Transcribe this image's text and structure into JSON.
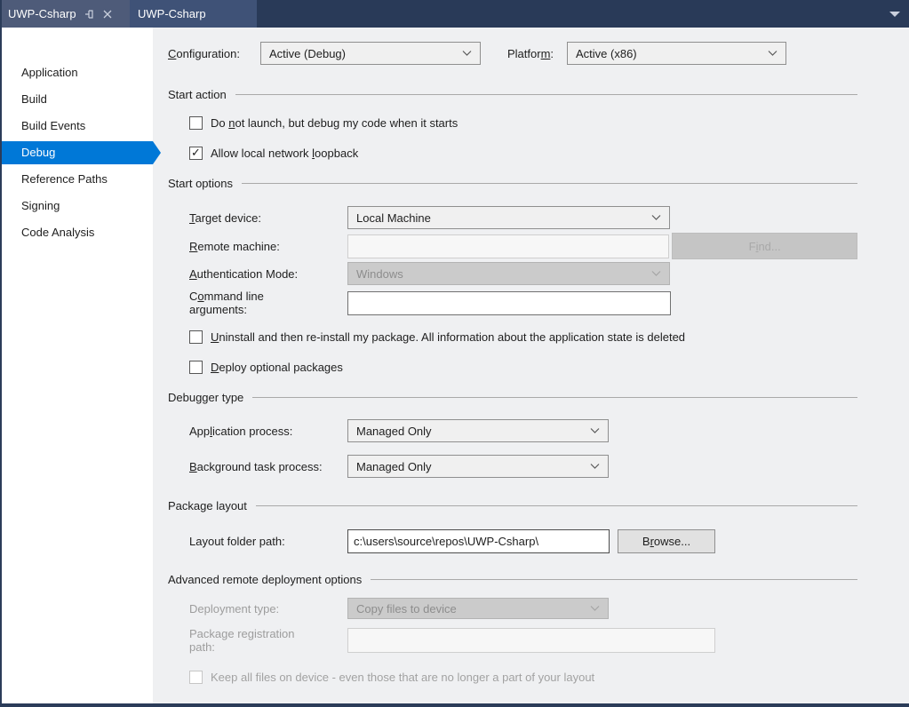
{
  "colors": {
    "accent_blue": "#0078d7",
    "tab_bar_bg": "#293a58",
    "active_tab_bg": "#4e5b79",
    "preview_tab_bg": "#3f5277",
    "sidebar_bg": "#ffffff",
    "content_bg": "#eff0f2",
    "disabled_control_bg": "#cbcbcb"
  },
  "icons": {
    "pin": "pin-icon",
    "close": "close-icon",
    "chevron_down": "chevron-down-icon",
    "tab_overflow": "dropdown-arrow-icon"
  },
  "tab_bar": {
    "tabs": [
      {
        "label": "UWP-Csharp",
        "active": true
      },
      {
        "label": "UWP-Csharp",
        "active": false
      }
    ]
  },
  "sidebar": {
    "items": [
      {
        "label": "Application",
        "selected": false
      },
      {
        "label": "Build",
        "selected": false
      },
      {
        "label": "Build Events",
        "selected": false
      },
      {
        "label": "Debug",
        "selected": true
      },
      {
        "label": "Reference Paths",
        "selected": false
      },
      {
        "label": "Signing",
        "selected": false
      },
      {
        "label": "Code Analysis",
        "selected": false
      }
    ]
  },
  "config_bar": {
    "configuration_label": {
      "pre": "",
      "accel": "C",
      "post": "onfiguration:"
    },
    "configuration_value": "Active (Debug)",
    "platform_label": {
      "pre": "Platfor",
      "accel": "m",
      "post": ":"
    },
    "platform_value": "Active (x86)"
  },
  "start_action": {
    "title": "Start action",
    "no_launch": {
      "pre": "Do ",
      "accel": "n",
      "post": "ot launch, but debug my code when it starts",
      "checked": false
    },
    "loopback": {
      "pre": "Allow local network ",
      "accel": "l",
      "post": "oopback",
      "checked": true
    }
  },
  "start_options": {
    "title": "Start options",
    "target_device": {
      "label": {
        "pre": "",
        "accel": "T",
        "post": "arget device:"
      },
      "value": "Local Machine",
      "enabled": true
    },
    "remote_machine": {
      "label": {
        "pre": "",
        "accel": "R",
        "post": "emote machine:"
      },
      "value": "",
      "enabled": false
    },
    "find_button": {
      "pre": "F",
      "accel": "i",
      "post": "nd...",
      "enabled": false
    },
    "authentication_mode": {
      "label": {
        "pre": "",
        "accel": "A",
        "post": "uthentication Mode:"
      },
      "value": "Windows",
      "enabled": false
    },
    "command_line_arguments": {
      "label": {
        "pre": "C",
        "accel": "o",
        "post": "mmand line arguments:"
      },
      "value": "",
      "enabled": true
    },
    "uninstall": {
      "pre": "",
      "accel": "U",
      "post": "ninstall and then re-install my package. All information about the application state is deleted",
      "checked": false
    },
    "deploy_optional": {
      "pre": "",
      "accel": "D",
      "post": "eploy optional packages",
      "checked": false
    }
  },
  "debugger_type": {
    "title": "Debugger type",
    "application_process": {
      "label": {
        "pre": "App",
        "accel": "l",
        "post": "ication process:"
      },
      "value": "Managed Only",
      "enabled": true
    },
    "background_task_process": {
      "label": {
        "pre": "",
        "accel": "B",
        "post": "ackground task process:"
      },
      "value": "Managed Only",
      "enabled": true
    }
  },
  "package_layout": {
    "title": "Package layout",
    "layout_folder_path": {
      "label": "Layout folder path:",
      "value": "c:\\users\\source\\repos\\UWP-Csharp\\",
      "enabled": true
    },
    "browse_button": {
      "pre": "B",
      "accel": "r",
      "post": "owse..."
    }
  },
  "advanced": {
    "title": "Advanced remote deployment options",
    "deployment_type": {
      "label": "Deployment type:",
      "value": "Copy files to device",
      "enabled": false
    },
    "package_registration_path": {
      "label_line1": "Package registration",
      "label_line2": "path:",
      "value": "",
      "enabled": false
    },
    "keep_all_files": {
      "label": "Keep all files on device - even those that are no longer a part of your layout",
      "checked": false,
      "enabled": false
    }
  }
}
